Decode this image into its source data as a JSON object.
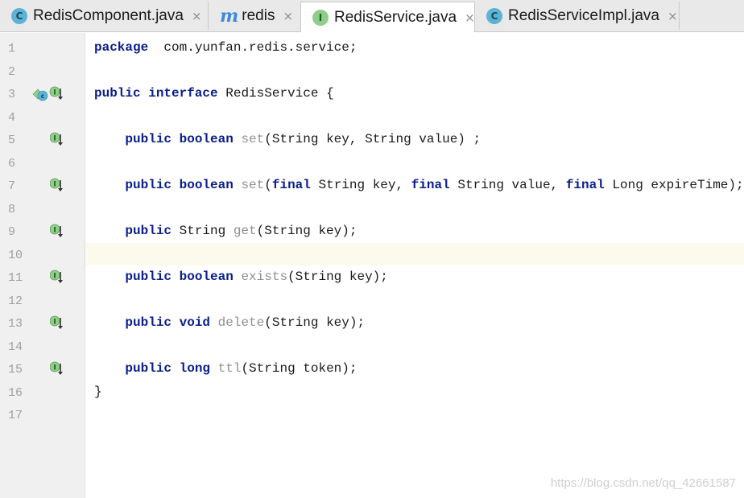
{
  "tabs": [
    {
      "label": "RedisComponent.java",
      "icon": "class-c-icon",
      "icon_glyph": "C",
      "active": false
    },
    {
      "label": "redis",
      "icon": "maven-icon",
      "icon_glyph": "m",
      "active": false
    },
    {
      "label": "RedisService.java",
      "icon": "interface-i-icon",
      "icon_glyph": "I",
      "active": true
    },
    {
      "label": "RedisServiceImpl.java",
      "icon": "class-c-icon",
      "icon_glyph": "C",
      "active": false
    }
  ],
  "close_glyph": "×",
  "lines": [
    {
      "num": "1",
      "tokens": [
        [
          "kw",
          "package"
        ],
        [
          "",
          "  com.yunfan.redis.service;"
        ]
      ],
      "gutter": ""
    },
    {
      "num": "2",
      "tokens": [],
      "gutter": ""
    },
    {
      "num": "3",
      "tokens": [
        [
          "kw",
          "public"
        ],
        [
          "",
          " "
        ],
        [
          "kw",
          "interface"
        ],
        [
          "",
          " RedisService {"
        ]
      ],
      "gutter": "implemented-with-class"
    },
    {
      "num": "4",
      "tokens": [],
      "gutter": ""
    },
    {
      "num": "5",
      "tokens": [
        [
          "",
          "    "
        ],
        [
          "kw",
          "public"
        ],
        [
          "",
          " "
        ],
        [
          "kw",
          "boolean"
        ],
        [
          "",
          " "
        ],
        [
          "fn",
          "set"
        ],
        [
          "",
          "(String key, String value) ;"
        ]
      ],
      "gutter": "implemented"
    },
    {
      "num": "6",
      "tokens": [],
      "gutter": ""
    },
    {
      "num": "7",
      "tokens": [
        [
          "",
          "    "
        ],
        [
          "kw",
          "public"
        ],
        [
          "",
          " "
        ],
        [
          "kw",
          "boolean"
        ],
        [
          "",
          " "
        ],
        [
          "fn",
          "set"
        ],
        [
          "",
          "("
        ],
        [
          "kw",
          "final"
        ],
        [
          "",
          " String key, "
        ],
        [
          "kw",
          "final"
        ],
        [
          "",
          " String value, "
        ],
        [
          "kw",
          "final"
        ],
        [
          "",
          " Long expireTime);"
        ]
      ],
      "gutter": "implemented"
    },
    {
      "num": "8",
      "tokens": [],
      "gutter": ""
    },
    {
      "num": "9",
      "tokens": [
        [
          "",
          "    "
        ],
        [
          "kw",
          "public"
        ],
        [
          "",
          " String "
        ],
        [
          "fn",
          "get"
        ],
        [
          "",
          "(String key);"
        ]
      ],
      "gutter": "implemented"
    },
    {
      "num": "10",
      "tokens": [],
      "gutter": "",
      "caret": true
    },
    {
      "num": "11",
      "tokens": [
        [
          "",
          "    "
        ],
        [
          "kw",
          "public"
        ],
        [
          "",
          " "
        ],
        [
          "kw",
          "boolean"
        ],
        [
          "",
          " "
        ],
        [
          "fn",
          "exists"
        ],
        [
          "",
          "(String key);"
        ]
      ],
      "gutter": "implemented"
    },
    {
      "num": "12",
      "tokens": [],
      "gutter": ""
    },
    {
      "num": "13",
      "tokens": [
        [
          "",
          "    "
        ],
        [
          "kw",
          "public"
        ],
        [
          "",
          " "
        ],
        [
          "kw",
          "void"
        ],
        [
          "",
          " "
        ],
        [
          "fn",
          "delete"
        ],
        [
          "",
          "(String key);"
        ]
      ],
      "gutter": "implemented"
    },
    {
      "num": "14",
      "tokens": [],
      "gutter": ""
    },
    {
      "num": "15",
      "tokens": [
        [
          "",
          "    "
        ],
        [
          "kw",
          "public"
        ],
        [
          "",
          " "
        ],
        [
          "kw",
          "long"
        ],
        [
          "",
          " "
        ],
        [
          "fn",
          "ttl"
        ],
        [
          "",
          "(String token);"
        ]
      ],
      "gutter": "implemented"
    },
    {
      "num": "16",
      "tokens": [
        [
          "",
          "}"
        ]
      ],
      "gutter": ""
    },
    {
      "num": "17",
      "tokens": [],
      "gutter": ""
    }
  ],
  "watermark": "https://blog.csdn.net/qq_42661587",
  "colors": {
    "keyword": "#0a1e8c",
    "method_name": "#8f8f8f",
    "caret_row": "#fcfaed",
    "gutter_bg": "#f0f0f0",
    "interface_icon": "#8fce8a",
    "class_icon": "#5eb2d4"
  }
}
